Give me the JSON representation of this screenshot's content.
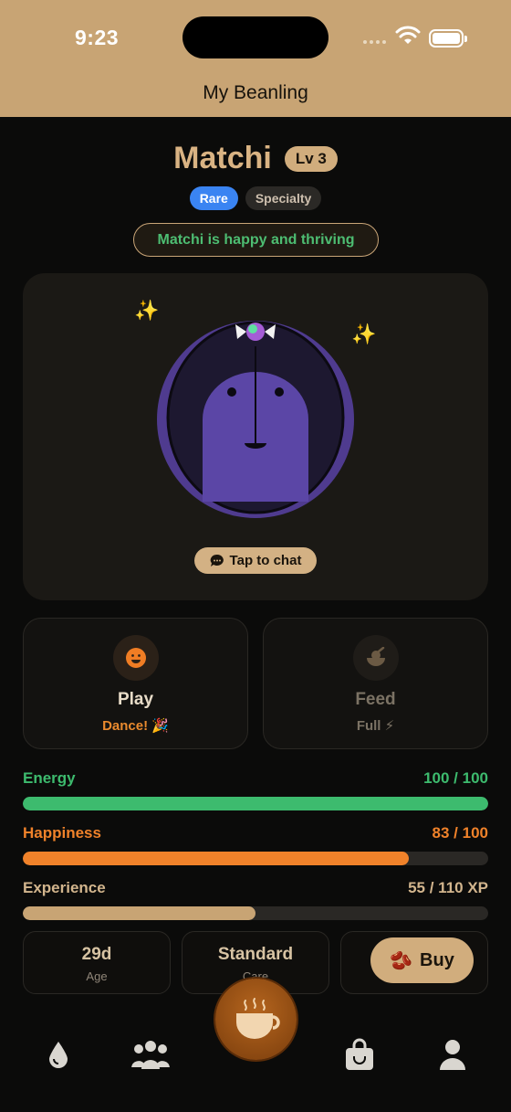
{
  "status_bar": {
    "time": "9:23"
  },
  "nav": {
    "title": "My Beanling"
  },
  "pet": {
    "name": "Matchi",
    "level": "Lv 3",
    "tags": [
      "Rare",
      "Specialty"
    ],
    "mood": "Matchi is happy and thriving",
    "chat_label": "Tap to chat"
  },
  "actions": [
    {
      "label": "Play",
      "sub": "Dance! 🎉",
      "color": "#e8dcc8",
      "sub_color": "#e98a2e"
    },
    {
      "label": "Feed",
      "sub": "Full ⚡",
      "color": "#7b7264",
      "sub_color": "#7b7264"
    }
  ],
  "stats": [
    {
      "label": "Energy",
      "value": "100 / 100",
      "fraction": 1.0,
      "color": "#3dbb6e"
    },
    {
      "label": "Happiness",
      "value": "83 / 100",
      "fraction": 0.83,
      "color": "#f0822a"
    },
    {
      "label": "Experience",
      "value": "55 / 110 XP",
      "fraction": 0.5,
      "color": "#c8a474"
    }
  ],
  "info": [
    {
      "value": "29d",
      "key": "Age"
    },
    {
      "value": "Standard",
      "key": "Care"
    }
  ],
  "buy_label": "Buy",
  "tabs": [
    "drop-icon",
    "community-icon",
    "coffee-cup-icon",
    "shopping-bag-icon",
    "profile-icon"
  ],
  "colors": {
    "accent": "#c8a474",
    "background": "#0b0b0a",
    "pet_purple": "#5a46a0"
  }
}
